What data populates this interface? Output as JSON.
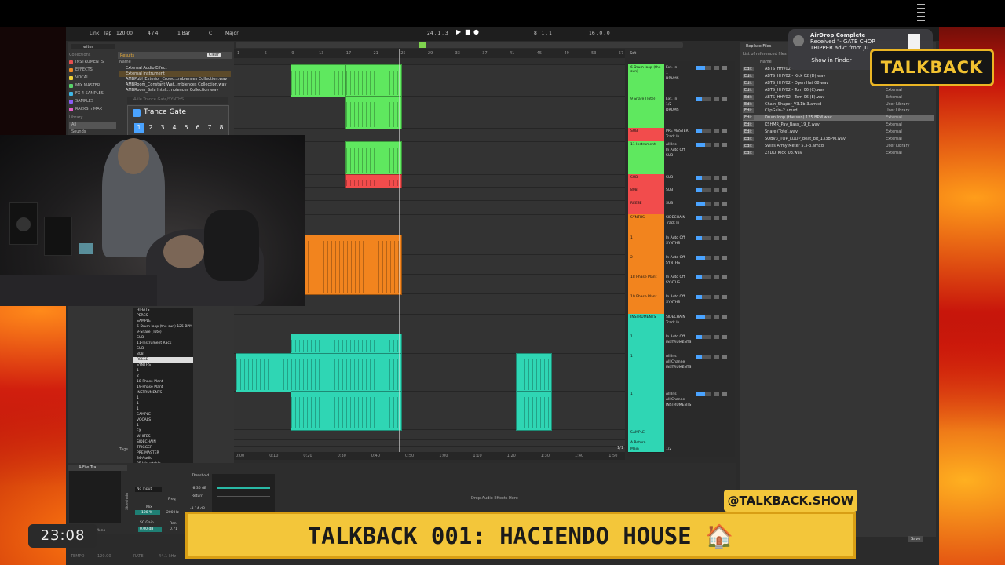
{
  "daw": {
    "top_labels": [
      "Link",
      "Tap",
      "120.00",
      "4 / 4",
      "1 Bar",
      "C",
      "Major"
    ],
    "transport": [
      "24 . 1 . 3",
      "8 . 1 . 1",
      "16 . 0 . 0"
    ],
    "browser": {
      "search_value": "witer",
      "collections_label": "Collections",
      "categories": [
        {
          "label": "INSTRUMENTS",
          "color": "#e84f4f"
        },
        {
          "label": "EFFECTS",
          "color": "#f08a24"
        },
        {
          "label": "VOCAL",
          "color": "#f2d23a"
        },
        {
          "label": "MIX MASTER",
          "color": "#59d36a"
        },
        {
          "label": "FX 4 SAMPLES",
          "color": "#3fb7e6"
        },
        {
          "label": "SAMPLES",
          "color": "#8a5cf5"
        },
        {
          "label": "RACKS n MAX",
          "color": "#e45cc7"
        }
      ],
      "library_label": "Library",
      "library_items": [
        "All",
        "Sounds"
      ],
      "results_label": "Results",
      "clear_label": "Clear",
      "name_col": "Name",
      "results": [
        "External Audio Effect",
        "External Instrument",
        "AMBPubl_Exterior_Crowd...mbiences Collection.wav",
        "AMBRoom_Constant Wat...mbiences Collection.wav",
        "AMBRoom_Sala Intel...mbiences Collection.wav"
      ],
      "tags_label": "Tags"
    },
    "device_popup": {
      "breadcrumb": "4-ile Trance Gate/SYNTHS",
      "title": "Trance Gate",
      "numbers": [
        "1",
        "2",
        "3",
        "4",
        "5",
        "6",
        "7",
        "8"
      ]
    },
    "ruler_marks": [
      "1",
      "5",
      "9",
      "13",
      "17",
      "21",
      "25",
      "29",
      "33",
      "37",
      "41",
      "45",
      "49",
      "53",
      "57"
    ],
    "time_marks": [
      "0:00",
      "0:10",
      "0:20",
      "0:30",
      "0:40",
      "0:50",
      "1:00",
      "1:10",
      "1:20",
      "1:30",
      "1:40",
      "1:50"
    ],
    "set_label": "Set",
    "tracks": [
      {
        "name": "6 Drum loop (the sun)",
        "color": "#5fe85f",
        "io": [
          "Ext. In",
          "1",
          "DRUMS"
        ]
      },
      {
        "name": "9 Snare (Tote)",
        "color": "#5fe85f",
        "io": [
          "Ext. In",
          "1/2",
          "DRUMS"
        ]
      },
      {
        "name": "SUB",
        "color": "#f24c4c",
        "io": [
          "PRE MASTER",
          "Track In"
        ]
      },
      {
        "name": "11 Instrument",
        "color": "#5fe85f",
        "io": [
          "All Ins",
          "In Auto Off",
          "SUB"
        ]
      },
      {
        "name": "SUB",
        "color": "#f24c4c",
        "io": [
          "SUB"
        ]
      },
      {
        "name": "808",
        "color": "#f24c4c",
        "io": [
          "SUB"
        ]
      },
      {
        "name": "REESE",
        "color": "#f24c4c",
        "io": [
          "SUB"
        ]
      },
      {
        "name": "SYNTHS",
        "color": "#f2841e",
        "io": [
          "SIDECHAIN",
          "Track In"
        ]
      },
      {
        "name": "1",
        "color": "#f2841e",
        "io": [
          "In Auto Off",
          "SYNTHS"
        ]
      },
      {
        "name": "2",
        "color": "#f2841e",
        "io": [
          "In Auto Off",
          "SYNTHS"
        ]
      },
      {
        "name": "18 Phase Plant",
        "color": "#f2841e",
        "io": [
          "In Auto Off",
          "SYNTHS"
        ]
      },
      {
        "name": "19 Phase Plant",
        "color": "#f2841e",
        "io": [
          "In Auto Off",
          "SYNTHS"
        ]
      },
      {
        "name": "INSTRUMENTS",
        "color": "#2fd6b4",
        "io": [
          "SIDECHAIN",
          "Track In"
        ]
      },
      {
        "name": "1",
        "color": "#2fd6b4",
        "io": [
          "In Auto Off",
          "INSTRUMENTS"
        ]
      },
      {
        "name": "1",
        "color": "#2fd6b4",
        "io": [
          "All Ins",
          "All Channe",
          "INSTRUMENTS"
        ]
      },
      {
        "name": "1",
        "color": "#2fd6b4",
        "io": [
          "All Ins",
          "All Channe",
          "INSTRUMENTS"
        ]
      },
      {
        "name": "SAMPLE",
        "color": "#2fd6b4",
        "io": []
      },
      {
        "name": "A Return",
        "color": "#2fd6b4",
        "io": []
      },
      {
        "name": "Main",
        "color": "#2fd6b4",
        "io": [
          "1/2"
        ]
      }
    ],
    "bar_position": "1/1",
    "dropdown_items": [
      "HIHATS",
      "PERCS",
      "SAMPLE",
      "6-Drum loop (the sun) 125 BPM",
      "9-Snare (Tote)",
      "SUB",
      "11-Instrument Rack",
      "SUB",
      "808",
      "REESE",
      "SYNTHS",
      "1",
      "2",
      "18-Phase Plant",
      "19-Phase Plant",
      "INSTRUMENTS",
      "1",
      "1",
      "1",
      "SAMPLE",
      "VOCALS",
      "1",
      "FX",
      "WHITES",
      "SIDECHAIN",
      "TRIGGER",
      "PRE MASTER",
      "34-Audio",
      "35-Wavetable",
      "A-Return",
      "Main",
      "No Input"
    ],
    "dropdown_selected": "REESE",
    "device_panel": {
      "name": "4-File Tra...",
      "input_value": "No Input",
      "drop_hint": "Drop Audio Effects Here",
      "knob_labels": [
        "Threshold",
        "Freq",
        "Return",
        "Mix",
        "SC Gain",
        "Ren"
      ],
      "knob_values": [
        "-8.36 dB",
        "200 Hz",
        "-3.14 dB",
        "100 %",
        "0.00 dB",
        "0.71"
      ],
      "mono_label": "Mono",
      "sidechain_label": "Sidechain"
    },
    "status": {
      "tempo_label": "TEMPO",
      "tempo": "120.00",
      "rate_label": "RATE",
      "rate": "44.1 kHz"
    }
  },
  "right_panel": {
    "header": "Replace Files",
    "subheader": "List of referenced files",
    "name_col": "Name",
    "files": [
      {
        "name": "ABTS_HHV02 -",
        "loc": "External"
      },
      {
        "name": "ABTS_HHV02 - Kick 02 (D).wav",
        "loc": "External"
      },
      {
        "name": "ABTS_HHV02 - Open Hat 08.wav",
        "loc": "External"
      },
      {
        "name": "ABTS_HHV02 - Tom 06 (C).wav",
        "loc": "External"
      },
      {
        "name": "ABTS_HHV02 - Tom 06 (E).wav",
        "loc": "External"
      },
      {
        "name": "Chain_Shaper_V3.1b-3.amxd",
        "loc": "User Library"
      },
      {
        "name": "ClipGain-2.amxd",
        "loc": "User Library"
      },
      {
        "name": "Drum loop (the sun) 125 BPM.wav",
        "loc": "External"
      },
      {
        "name": "KSHMR_Pay_Bass_19_E.wav",
        "loc": "External"
      },
      {
        "name": "Snare (Tote).wav",
        "loc": "External"
      },
      {
        "name": "SOBV3_TOP_LOOP_beat_pit_133BPM.wav",
        "loc": "External"
      },
      {
        "name": "Swiss Army Meter 5.3-3.amxd",
        "loc": "User Library"
      },
      {
        "name": "ZYDO_Kick_03.wav",
        "loc": "External"
      }
    ],
    "edit_label": "Edit",
    "save_label": "Save"
  },
  "airdrop": {
    "title": "AirDrop Complete",
    "body": "Received \"- GATE CHOP TRIPPER.adv\" from Ju...",
    "button": "Show in Finder"
  },
  "overlay": {
    "logo": "TALKBACK",
    "handle": "@TALKBACK.SHOW",
    "title": "TALKBACK 001: HACIENDO HOUSE 🏠",
    "timer": "23:08"
  },
  "colors": {
    "accent": "#f3c63a",
    "green": "#5fe85f",
    "red": "#f24c4c",
    "orange": "#f2841e",
    "teal": "#2fd6b4"
  }
}
